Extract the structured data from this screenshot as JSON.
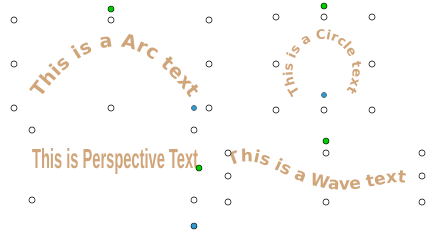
{
  "artwork": {
    "fill_color": "#D0A57A",
    "handle_color": "#ffffff",
    "handle_stroke": "#000000",
    "rotate_handle_color": "#00CC00",
    "adjust_handle_color": "#3399CC",
    "objects": [
      {
        "id": "arc",
        "text": "This is a Arc text",
        "style": "arch-up",
        "selected": true
      },
      {
        "id": "circle",
        "text": "This is a Circle text",
        "style": "circle",
        "selected": true
      },
      {
        "id": "perspective",
        "text": "This is Perspective Text",
        "style": "perspective",
        "selected": true
      },
      {
        "id": "wave",
        "text": "This is a Wave text",
        "style": "wave",
        "selected": true
      }
    ]
  }
}
